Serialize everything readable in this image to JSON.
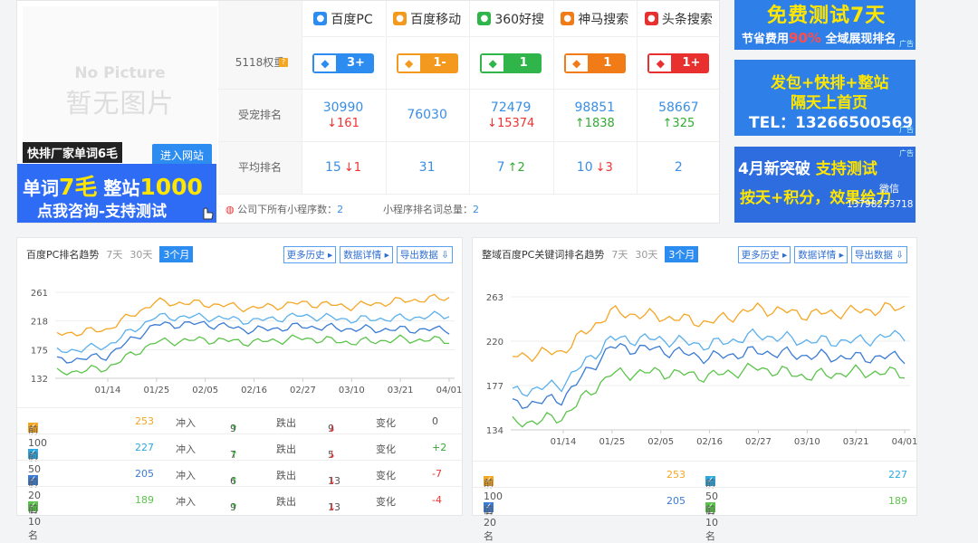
{
  "site": {
    "no_picture_en": "No Picture",
    "no_picture_cn": "暂无图片",
    "tag": "快排厂家单词6毛",
    "enter_button": "进入网站",
    "ad_line1_pre": "单词",
    "ad_line1_num": "7毛",
    "ad_line1_mid": "整站",
    "ad_line1_num2": "1000",
    "ad_line2": "点我咨询-支持测试"
  },
  "table": {
    "row_labels": [
      "5118权重",
      "受宠排名",
      "平均排名"
    ],
    "engines": [
      {
        "name": "百度PC",
        "icon": "baidu-paw-icon",
        "color": "#2d8cf0",
        "badge": "3+",
        "rank": "30990",
        "rank_change": "161",
        "rank_dir": "down",
        "avg": "15",
        "avg_change": "1",
        "avg_dir": "down"
      },
      {
        "name": "百度移动",
        "icon": "baidu-paw-icon",
        "color": "#f39a1e",
        "badge": "1-",
        "rank": "76030",
        "rank_change": "",
        "rank_dir": "",
        "avg": "31",
        "avg_change": "",
        "avg_dir": ""
      },
      {
        "name": "360好搜",
        "icon": "360-search-icon",
        "color": "#2fb54a",
        "badge": "1",
        "rank": "72479",
        "rank_change": "15374",
        "rank_dir": "down",
        "avg": "7",
        "avg_change": "2",
        "avg_dir": "up"
      },
      {
        "name": "神马搜索",
        "icon": "shenma-icon",
        "color": "#f07b17",
        "badge": "1",
        "rank": "98851",
        "rank_change": "1838",
        "rank_dir": "up",
        "avg": "10",
        "avg_change": "3",
        "avg_dir": "down"
      },
      {
        "name": "头条搜索",
        "icon": "toutiao-icon",
        "color": "#e8302e",
        "badge": "1+",
        "rank": "58667",
        "rank_change": "325",
        "rank_dir": "up",
        "avg": "2",
        "avg_change": "",
        "avg_dir": ""
      }
    ],
    "footer1_label": "公司下所有小程序数：",
    "footer1_value": "2",
    "footer2_label": "小程序排名词总量：",
    "footer2_value": "2"
  },
  "ads_right": [
    {
      "line1": "免费测试7天",
      "line2a": "节省费用",
      "line2b": "90%",
      "line2c": "全域展现排名",
      "tag": "广告"
    },
    {
      "line1": "发包+快排+整站",
      "line2": "隔天上首页",
      "line3": "TEL：13266500569",
      "tag": "广告"
    },
    {
      "line1a": "4月新突破",
      "line1b": "支持测试",
      "line2": "按天+积分，效果给力",
      "line3a": "微信",
      "line3b": "13798273718",
      "tag": "广告"
    }
  ],
  "chart_left_ui": {
    "title": "百度PC排名趋势",
    "tabs": [
      "7天",
      "30天",
      "3个月"
    ],
    "buttons": [
      "更多历史",
      "数据详情",
      "导出数据"
    ],
    "stats": [
      {
        "label": "前100名",
        "value": "253",
        "color": "#f5a623",
        "in_label": "冲入",
        "in": "9",
        "out_label": "跌出",
        "out": "9",
        "chg_label": "变化",
        "chg": "0"
      },
      {
        "label": "前50名",
        "value": "227",
        "color": "#2da8e0",
        "in_label": "冲入",
        "in": "7",
        "out_label": "跌出",
        "out": "5",
        "chg_label": "变化",
        "chg": "+2"
      },
      {
        "label": "前20名",
        "value": "205",
        "color": "#3a7bd5",
        "in_label": "冲入",
        "in": "6",
        "out_label": "跌出",
        "out": "13",
        "chg_label": "变化",
        "chg": "-7"
      },
      {
        "label": "前10名",
        "value": "189",
        "color": "#5bc44a",
        "in_label": "冲入",
        "in": "9",
        "out_label": "跌出",
        "out": "13",
        "chg_label": "变化",
        "chg": "-4"
      }
    ]
  },
  "chart_right_ui": {
    "title": "整域百度PC关键词排名趋势",
    "tabs": [
      "7天",
      "30天",
      "3个月"
    ],
    "buttons": [
      "更多历史",
      "数据详情",
      "导出数据"
    ],
    "stats": [
      {
        "label": "前100名",
        "value": "253",
        "color": "#f5a623"
      },
      {
        "label": "前50名",
        "value": "227",
        "color": "#2da8e0"
      },
      {
        "label": "前20名",
        "value": "205",
        "color": "#3a7bd5"
      },
      {
        "label": "前10名",
        "value": "189",
        "color": "#5bc44a"
      }
    ]
  },
  "chart_data": [
    {
      "type": "line",
      "x": [
        "01/14",
        "01/25",
        "02/05",
        "02/16",
        "02/27",
        "03/10",
        "03/21",
        "04/01"
      ],
      "yticks": [
        132,
        175,
        218,
        261
      ],
      "ylim": [
        132,
        261
      ],
      "series": [
        {
          "name": "前100名",
          "color": "#f5a623",
          "values": [
            198,
            205,
            246,
            244,
            237,
            245,
            240,
            248,
            253
          ]
        },
        {
          "name": "前50名",
          "color": "#5ab0ee",
          "values": [
            172,
            180,
            224,
            224,
            218,
            226,
            220,
            222,
            227
          ]
        },
        {
          "name": "前20名",
          "color": "#3a7bd5",
          "values": [
            158,
            165,
            212,
            214,
            204,
            210,
            206,
            205,
            205
          ]
        },
        {
          "name": "前10名",
          "color": "#5bc44a",
          "values": [
            140,
            147,
            186,
            190,
            186,
            192,
            186,
            190,
            189
          ]
        }
      ]
    },
    {
      "type": "line",
      "x": [
        "01/14",
        "01/25",
        "02/05",
        "02/16",
        "02/27",
        "03/10",
        "03/21",
        "04/01"
      ],
      "yticks": [
        134,
        177,
        220,
        263
      ],
      "ylim": [
        134,
        263
      ],
      "series": [
        {
          "name": "前100名",
          "color": "#f5a623",
          "values": [
            205,
            210,
            248,
            244,
            238,
            252,
            246,
            249,
            253
          ]
        },
        {
          "name": "前50名",
          "color": "#5ab0ee",
          "values": [
            170,
            178,
            222,
            222,
            216,
            226,
            220,
            220,
            227
          ]
        },
        {
          "name": "前20名",
          "color": "#3a7bd5",
          "values": [
            158,
            164,
            214,
            212,
            204,
            210,
            206,
            204,
            205
          ]
        },
        {
          "name": "前10名",
          "color": "#5bc44a",
          "values": [
            140,
            146,
            188,
            190,
            186,
            194,
            186,
            190,
            189
          ]
        }
      ]
    }
  ]
}
